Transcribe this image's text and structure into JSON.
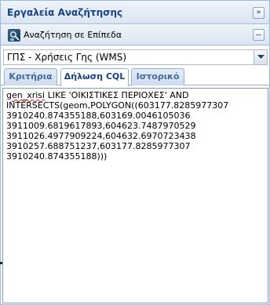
{
  "panel": {
    "title": "Εργαλεία Αναζήτησης",
    "collapse_icon": "double-chevron-right-icon",
    "collapse_glyph": "»"
  },
  "subpanel": {
    "title": "Αναζήτηση σε Επίπεδα",
    "icon": "layer-search-icon"
  },
  "layer_select": {
    "value": "ΓΠΣ - Χρήσεις Γης (WMS)"
  },
  "tabs": [
    {
      "label": "Κριτήρια",
      "active": false
    },
    {
      "label": "Δήλωση CQL",
      "active": true
    },
    {
      "label": "Ιστορικό",
      "active": false
    }
  ],
  "cql": {
    "field": "gen_xrisi",
    "text": " LIKE 'ΟΙΚΙΣΤΙΚΕΣ ΠΕΡΙΟΧΕΣ' AND\nINTERSECTS(geom,POLYGON((603177.8285977307\n3910240.874355188,603169.0046105036\n3911009.6819617893,604623.7487970529\n3911026.4977909224,604632.6970723438\n3910257.688751237,603177.8285977307\n3910240.874355188)))"
  },
  "colors": {
    "header_text": "#15428b",
    "border": "#99bbe8"
  }
}
